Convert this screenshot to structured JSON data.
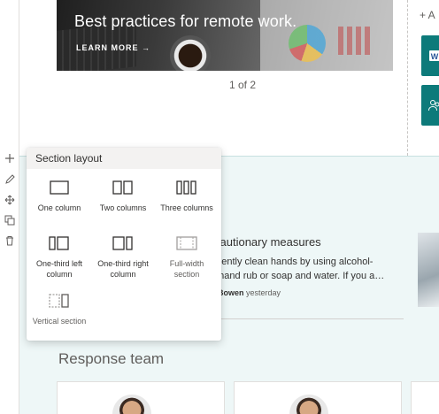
{
  "hero": {
    "title": "Best practices for remote work.",
    "cta": "LEARN MORE →",
    "pager": "1 of 2"
  },
  "right_panel": {
    "add_label": "+ A"
  },
  "toolbar": {
    "icons": [
      "plus-icon",
      "edit-icon",
      "move-icon",
      "duplicate-icon",
      "delete-icon"
    ]
  },
  "news": {
    "title": "cautionary measures",
    "body_line1": "quently clean hands by using alcohol-",
    "body_line2": "d hand rub or soap and water. If you a…",
    "author": "n Bowen",
    "date": "yesterday",
    "meta_tail": "y"
  },
  "response_team": {
    "title": "Response team"
  },
  "section_layout": {
    "title": "Section layout",
    "options": [
      {
        "label": "One column",
        "icon": "one-column-icon"
      },
      {
        "label": "Two columns",
        "icon": "two-columns-icon"
      },
      {
        "label": "Three columns",
        "icon": "three-columns-icon"
      },
      {
        "label": "One-third left column",
        "icon": "one-third-left-icon"
      },
      {
        "label": "One-third right column",
        "icon": "one-third-right-icon"
      },
      {
        "label": "Full-width section",
        "icon": "full-width-icon"
      },
      {
        "label": "Vertical section",
        "icon": "vertical-section-icon"
      }
    ]
  },
  "colors": {
    "accent": "#0d7a7a",
    "section_bg": "#eef7f7"
  }
}
